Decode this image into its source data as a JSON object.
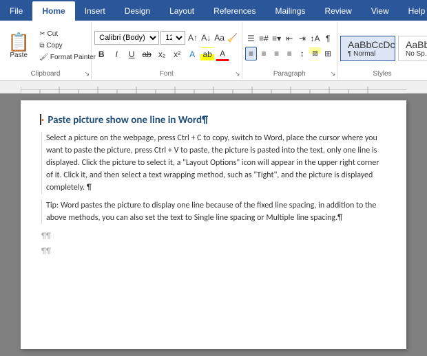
{
  "tabs": [
    {
      "label": "File",
      "active": false
    },
    {
      "label": "Home",
      "active": true
    },
    {
      "label": "Insert",
      "active": false
    },
    {
      "label": "Design",
      "active": false
    },
    {
      "label": "Layout",
      "active": false
    },
    {
      "label": "References",
      "active": false
    },
    {
      "label": "Mailings",
      "active": false
    },
    {
      "label": "Review",
      "active": false
    },
    {
      "label": "View",
      "active": false
    },
    {
      "label": "Help",
      "active": false
    }
  ],
  "clipboard": {
    "paste_label": "Paste",
    "cut_label": "Cut",
    "copy_label": "Copy",
    "format_painter_label": "Format Painter",
    "group_label": "Clipboard"
  },
  "font": {
    "family": "Calibri (Body)",
    "size": "12",
    "group_label": "Font"
  },
  "paragraph": {
    "group_label": "Paragraph"
  },
  "styles": {
    "group_label": "Styles",
    "normal_label": "Normal",
    "no_spacing_label": "No Sp..."
  },
  "styles_dropdown": {
    "normal": "¶ Normal",
    "no_spacing": "No Sp..."
  },
  "document": {
    "heading": "Paste picture show one line in Word¶",
    "paragraph1": "Select a picture on the webpage, press Ctrl + C to copy, switch to Word, place the cursor where you want to paste the picture, press Ctrl + V to paste, the picture is pasted into the text, only one line is displayed. Click the picture to select it, a \"Layout Options\" icon will appear in the upper right corner of it. Click it, and then select a text wrapping method, such as \"Tight\", and the picture is displayed completely. ¶",
    "paragraph2": "Tip: Word pastes the picture to display one line because of the fixed line spacing, in addition to the above methods, you can also set the text to Single line spacing or Multiple line spacing.¶",
    "empty1": "¶¶",
    "empty2": "¶¶"
  },
  "cursor_visible": true
}
